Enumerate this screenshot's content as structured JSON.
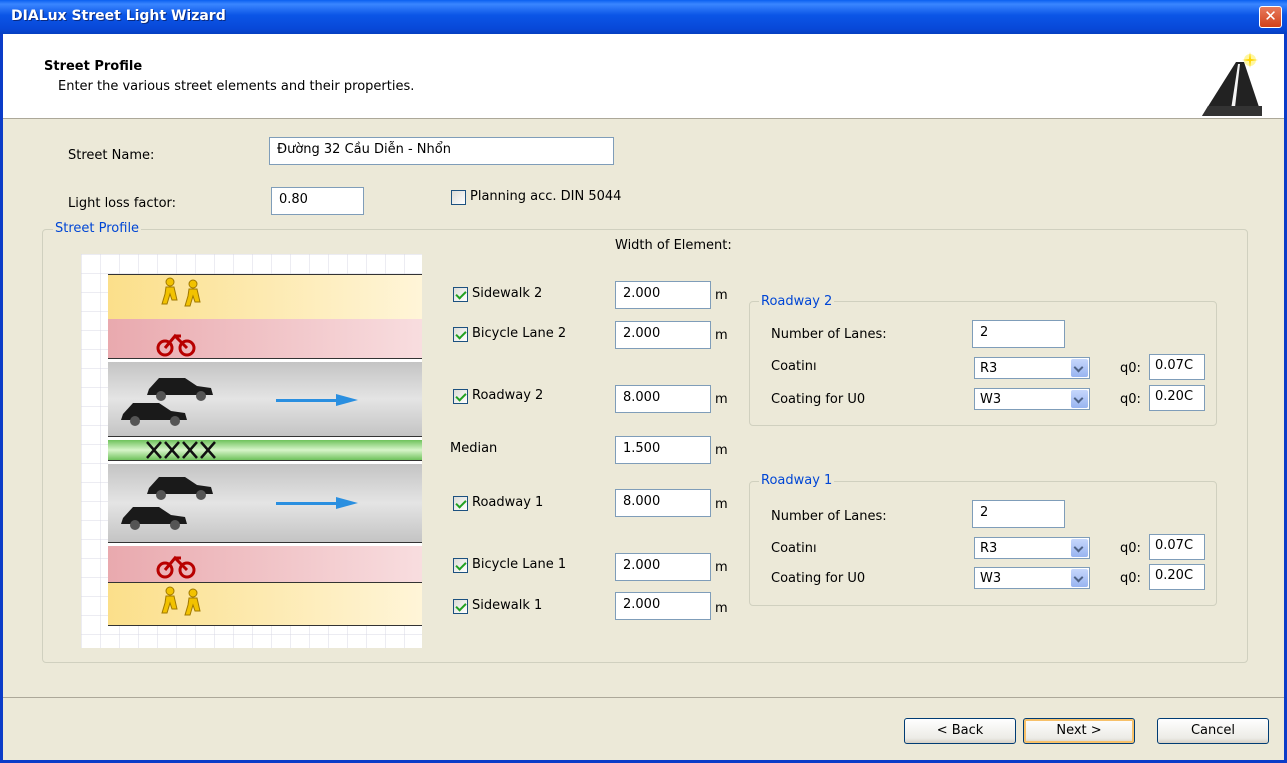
{
  "window": {
    "title": "DIALux Street Light Wizard",
    "close_glyph": "✕"
  },
  "header": {
    "title": "Street Profile",
    "subtitle": "Enter the various street elements and their properties.",
    "icon": "road-icon"
  },
  "form": {
    "street_name_label": "Street Name:",
    "street_name_value": "Đường 32 Cầu Diễn - Nhổn",
    "llf_label": "Light loss factor:",
    "llf_value": "0.80",
    "din_label": "Planning acc. DIN 5044",
    "din_checked": false
  },
  "profile": {
    "legend": "Street Profile",
    "width_header": "Width of Element:",
    "unit": "m",
    "elements": [
      {
        "label": "Sidewalk 2",
        "value": "2.000",
        "checked": true
      },
      {
        "label": "Bicycle Lane 2",
        "value": "2.000",
        "checked": true
      },
      {
        "label": "Roadway 2",
        "value": "8.000",
        "checked": true
      },
      {
        "label": "Median",
        "value": "1.500"
      },
      {
        "label": "Roadway 1",
        "value": "8.000",
        "checked": true
      },
      {
        "label": "Bicycle Lane 1",
        "value": "2.000",
        "checked": true
      },
      {
        "label": "Sidewalk 1",
        "value": "2.000",
        "checked": true
      }
    ]
  },
  "roadway2": {
    "legend": "Roadway 2",
    "lanes_label": "Number of Lanes:",
    "lanes_value": "2",
    "coating_label": "Coatinı",
    "coating_value": "R3",
    "q0_label": "q0:",
    "q0_value": "0.07C",
    "coating_u0_label": "Coating for U0",
    "coating_u0_value": "W3",
    "q0_u0_label": "q0:",
    "q0_u0_value": "0.20C"
  },
  "roadway1": {
    "legend": "Roadway 1",
    "lanes_label": "Number of Lanes:",
    "lanes_value": "2",
    "coating_label": "Coatinı",
    "coating_value": "R3",
    "q0_label": "q0:",
    "q0_value": "0.07C",
    "coating_u0_label": "Coating for U0",
    "coating_u0_value": "W3",
    "q0_u0_label": "q0:",
    "q0_u0_value": "0.20C"
  },
  "buttons": {
    "back": "< Back",
    "next": "Next >",
    "cancel": "Cancel"
  },
  "colors": {
    "titlebar": "#0b55e6",
    "sidewalk": "#fdeab0",
    "bicycle_lane": "#f0c6c8",
    "roadway": "#cfcfcf",
    "median": "#9fdc8c",
    "arrow": "#2a8fe0",
    "legend_text": "#0046d5"
  }
}
